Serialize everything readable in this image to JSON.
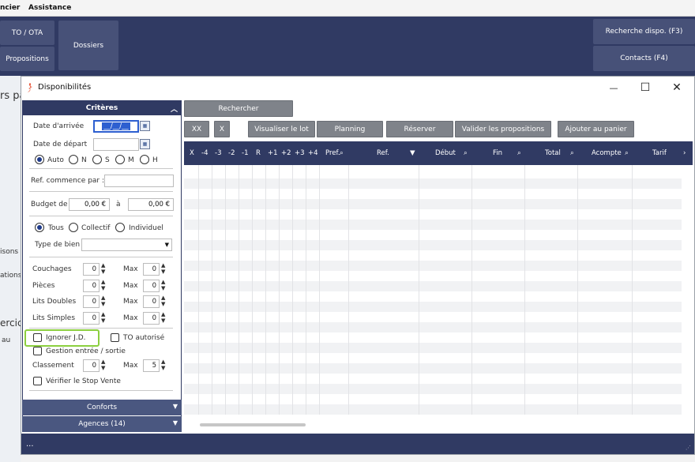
{
  "menu": {
    "item1": "ncier",
    "item2": "Assistance"
  },
  "appbar": {
    "to_ota": "TO / OTA",
    "dossiers": "Dossiers",
    "propositions": "Propositions",
    "recherche": "Recherche dispo. (F3)",
    "contacts": "Contacts (F4)"
  },
  "background": {
    "frag1": "rs pa",
    "frag2": "isons",
    "frag3": "ations",
    "frag4": "ercic",
    "frag5": "au"
  },
  "window": {
    "title": "Disponibilités",
    "minimize": "—",
    "maximize": "☐",
    "close": "✕"
  },
  "criteria": {
    "header": "Critères",
    "arrival_label": "Date d'arrivée",
    "arrival_value": "__/__/__",
    "departure_label": "Date de départ",
    "mode_options": [
      "Auto",
      "N",
      "S",
      "M",
      "H"
    ],
    "ref_label": "Ref. commence par :",
    "budget_label": "Budget de",
    "budget_from": "0,00 €",
    "budget_to_label": "à",
    "budget_to": "0,00 €",
    "type_options": [
      "Tous",
      "Collectif",
      "Individuel"
    ],
    "bien_label": "Type de bien",
    "rows": [
      {
        "label": "Couchages",
        "min": "0",
        "max_label": "Max",
        "max": "0"
      },
      {
        "label": "Pièces",
        "min": "0",
        "max_label": "Max",
        "max": "0"
      },
      {
        "label": "Lits Doubles",
        "min": "0",
        "max_label": "Max",
        "max": "0"
      },
      {
        "label": "Lits Simples",
        "min": "0",
        "max_label": "Max",
        "max": "0"
      }
    ],
    "ignorer_jd": "Ignorer J.D.",
    "to_autorise": "TO autorisé",
    "gestion": "Gestion entrée / sortie",
    "classement_label": "Classement",
    "classement_min": "0",
    "classement_max_label": "Max",
    "classement_max": "5",
    "stop_vente": "Vérifier le Stop Vente",
    "conforts": "Conforts",
    "agences": "Agences (14)"
  },
  "toolbar": {
    "rechercher": "Rechercher",
    "xx": "XX",
    "x": "X",
    "visualiser": "Visualiser le lot",
    "planning": "Planning",
    "reserver": "Réserver",
    "valider": "Valider les propositions",
    "ajouter": "Ajouter au panier"
  },
  "grid": {
    "columns": [
      "X",
      "-4",
      "-3",
      "-2",
      "-1",
      "R",
      "+1",
      "+2",
      "+3",
      "+4",
      "Pref.",
      "Ref.",
      "Début",
      "Fin",
      "Total",
      "Acompte",
      "Tarif"
    ]
  },
  "status": {
    "text": "..."
  },
  "colors": {
    "navy": "#303a63",
    "button_gray": "#7f838a",
    "highlight": "#8ccf3f"
  }
}
